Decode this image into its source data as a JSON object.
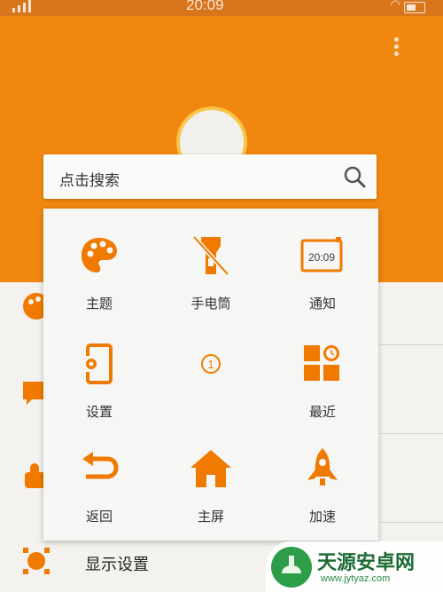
{
  "status_bar": {
    "time": "20:09"
  },
  "header": {
    "title": ""
  },
  "search": {
    "placeholder": "点击搜索"
  },
  "quick_panel": {
    "tiles": [
      {
        "label": "主题",
        "icon": "palette-icon"
      },
      {
        "label": "手电筒",
        "icon": "flashlight-off-icon"
      },
      {
        "label": "通知",
        "icon": "notification-clock-icon",
        "icon_text": "20:09"
      },
      {
        "label": "设置",
        "icon": "settings-tablet-icon"
      },
      {
        "label": "",
        "icon": "page-indicator-icon",
        "icon_text": "1"
      },
      {
        "label": "最近",
        "icon": "recent-apps-icon"
      },
      {
        "label": "返回",
        "icon": "back-arrow-icon"
      },
      {
        "label": "主屏",
        "icon": "home-icon"
      },
      {
        "label": "加速",
        "icon": "rocket-icon"
      }
    ]
  },
  "background_list": {
    "display_settings_label": "显示设置"
  },
  "watermark": {
    "name": "天源安卓网",
    "url": "www.jytyaz.com"
  },
  "colors": {
    "accent": "#f07a00",
    "header": "#f0870f"
  }
}
